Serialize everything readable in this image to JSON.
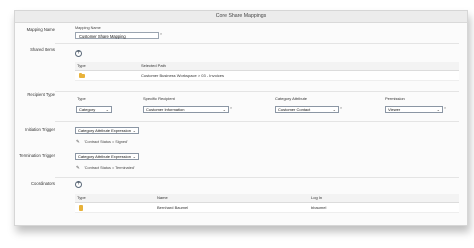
{
  "window": {
    "title": "Core Share Mappings"
  },
  "mapping_name": {
    "label": "Mapping Name",
    "field_caption": "Mapping Name",
    "value": "Customer Share Mapping",
    "clear_mark": "×"
  },
  "shared_items": {
    "label": "Shared Items",
    "columns": [
      "Type",
      "Selected Path"
    ],
    "rows": [
      {
        "type_icon": "folder-icon",
        "path": "Customer Business Workspace > 03 - Invoices"
      }
    ]
  },
  "recipient_type": {
    "label": "Recipient Type",
    "columns": [
      "Type",
      "Specific Recipient",
      "Category Attribute",
      "Permission"
    ],
    "row": {
      "type": "Category",
      "specific_recipient": "Customer Information",
      "category_attribute": "Customer Contact",
      "permission": "Viewer"
    }
  },
  "initiation_trigger": {
    "label": "Initiation Trigger",
    "select": "Category Attribute Expression",
    "expression": "'Contract Status = Signed'"
  },
  "termination_trigger": {
    "label": "Termination Trigger",
    "select": "Category Attribute Expression",
    "expression": "'Contract Status = Terminated'"
  },
  "coordinators": {
    "label": "Coordinators",
    "columns": [
      "Type",
      "Name",
      "Log In"
    ],
    "rows": [
      {
        "type_icon": "user-icon",
        "name": "Bernhard Baumel",
        "login": "bbaumel"
      }
    ]
  },
  "icons": {
    "add": "plus-circle-icon",
    "edit": "pencil-icon",
    "caret": "chevron-down-icon",
    "clear": "close-icon"
  },
  "colors": {
    "folder": "#e8b23a",
    "border": "#8b96a4",
    "header_bg": "#f3f3f3"
  }
}
